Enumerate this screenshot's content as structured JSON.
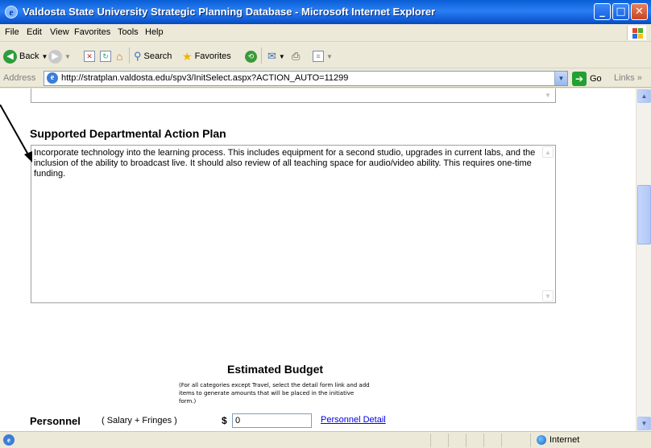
{
  "window": {
    "title": "Valdosta State University Strategic Planning Database - Microsoft Internet Explorer",
    "minimize": "_",
    "maximize": "□",
    "close": "✕"
  },
  "menu": [
    "File",
    "Edit",
    "View",
    "Favorites",
    "Tools",
    "Help"
  ],
  "toolbar": {
    "back": "Back",
    "search": "Search",
    "favorites": "Favorites"
  },
  "address": {
    "label": "Address",
    "url": "http://stratplan.valdosta.edu/spv3/InitSelect.aspx?ACTION_AUTO=11299",
    "go": "Go",
    "links": "Links"
  },
  "main": {
    "section_heading": "Supported Departmental Action Plan",
    "action_plan_text": "Incorporate technology into the learning process. This includes equipment for a second studio, upgrades in current labs, and the inclusion of the ability to broadcast live. It should also review of all teaching space for audio/video ability. This requires one-time funding.",
    "budget_title": "Estimated Budget",
    "budget_note": "(For all categories except Travel, select the detail form link and add items to generate amounts that will be placed in the initiative form.)",
    "personnel": {
      "label": "Personnel",
      "sublabel": "( Salary + Fringes )",
      "currency": "$",
      "amount": "0",
      "detail_link": "Personnel Detail"
    }
  },
  "status": {
    "zone": "Internet"
  },
  "colors": {
    "titlebar": "#0a5fd6",
    "chrome": "#ece9d8",
    "link": "#0000ee"
  }
}
